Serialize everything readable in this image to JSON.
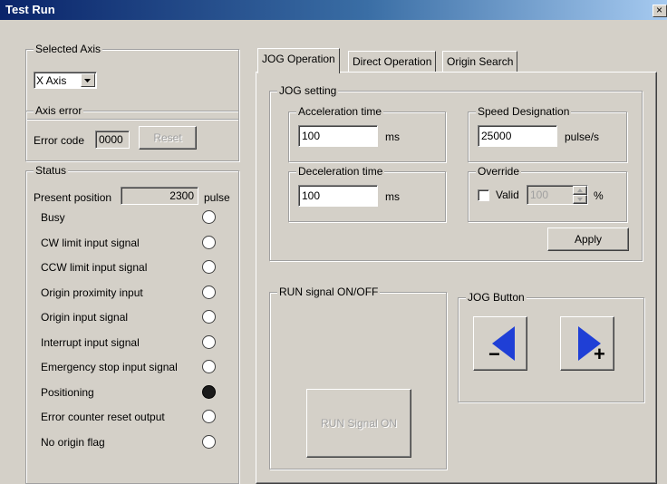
{
  "window": {
    "title": "Test Run",
    "close_glyph": "×"
  },
  "selected_axis": {
    "group_label": "Selected Axis",
    "value": "X Axis"
  },
  "axis_error": {
    "group_label": "Axis error",
    "error_code_label": "Error code",
    "error_code": "0000",
    "reset_label": "Reset"
  },
  "status": {
    "group_label": "Status",
    "present_position_label": "Present position",
    "present_position": "2300",
    "unit": "pulse",
    "signals": [
      {
        "label": "Busy",
        "on": false
      },
      {
        "label": "CW limit input signal",
        "on": false
      },
      {
        "label": "CCW limit input signal",
        "on": false
      },
      {
        "label": "Origin proximity input",
        "on": false
      },
      {
        "label": "Origin input signal",
        "on": false
      },
      {
        "label": "Interrupt input signal",
        "on": false
      },
      {
        "label": "Emergency stop input signal",
        "on": false
      },
      {
        "label": "Positioning",
        "on": true
      },
      {
        "label": "Error counter reset output",
        "on": false
      },
      {
        "label": "No origin flag",
        "on": false
      }
    ]
  },
  "tabs": [
    {
      "label": "JOG Operation",
      "active": true
    },
    {
      "label": "Direct Operation",
      "active": false
    },
    {
      "label": "Origin Search",
      "active": false
    }
  ],
  "jog_setting": {
    "group_label": "JOG setting",
    "acceleration": {
      "label": "Acceleration time",
      "value": "100",
      "unit": "ms"
    },
    "deceleration": {
      "label": "Deceleration time",
      "value": "100",
      "unit": "ms"
    },
    "speed": {
      "label": "Speed Designation",
      "value": "25000",
      "unit": "pulse/s"
    },
    "override": {
      "label": "Override",
      "valid_label": "Valid",
      "valid_checked": false,
      "value": "100",
      "unit": "%"
    },
    "apply_label": "Apply"
  },
  "run_signal": {
    "group_label": "RUN signal ON/OFF",
    "button_label": "RUN Signal ON"
  },
  "jog_button": {
    "group_label": "JOG Button",
    "minus_symbol": "−",
    "plus_symbol": "+"
  },
  "colors": {
    "titlebar_start": "#0a246a",
    "titlebar_end": "#a6caf0",
    "face": "#d4d0c8",
    "arrow_blue": "#1f3fd6"
  }
}
